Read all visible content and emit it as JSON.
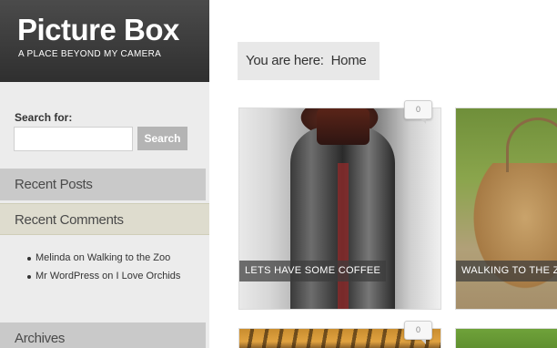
{
  "site": {
    "title": "Picture Box",
    "tagline": "A PLACE BEYOND MY CAMERA"
  },
  "sidebar": {
    "search": {
      "label": "Search for:",
      "placeholder": "",
      "value": "",
      "button_label": "Search"
    },
    "sections": {
      "recent_posts": "Recent Posts",
      "recent_comments": "Recent Comments",
      "archives": "Archives"
    },
    "comments": [
      {
        "author": "Melinda",
        "on": "on",
        "post": "Walking to the Zoo"
      },
      {
        "author": "Mr WordPress",
        "on": "on",
        "post": "I Love Orchids"
      }
    ]
  },
  "breadcrumb": {
    "prefix": "You are here:",
    "current": "Home"
  },
  "posts": [
    {
      "caption": "LETS HAVE SOME COFFEE",
      "comment_count": "0"
    },
    {
      "caption": "WALKING TO THE ZOO",
      "comment_count": ""
    },
    {
      "caption": "",
      "comment_count": "0"
    },
    {
      "caption": "",
      "comment_count": ""
    }
  ],
  "colors": {
    "header_bg": "#3a3a3a",
    "sidebar_bg": "#ececec",
    "section_bg": "#c9c9c9",
    "active_section_bg": "#dedcce",
    "search_button_bg": "#b4b4b4"
  }
}
